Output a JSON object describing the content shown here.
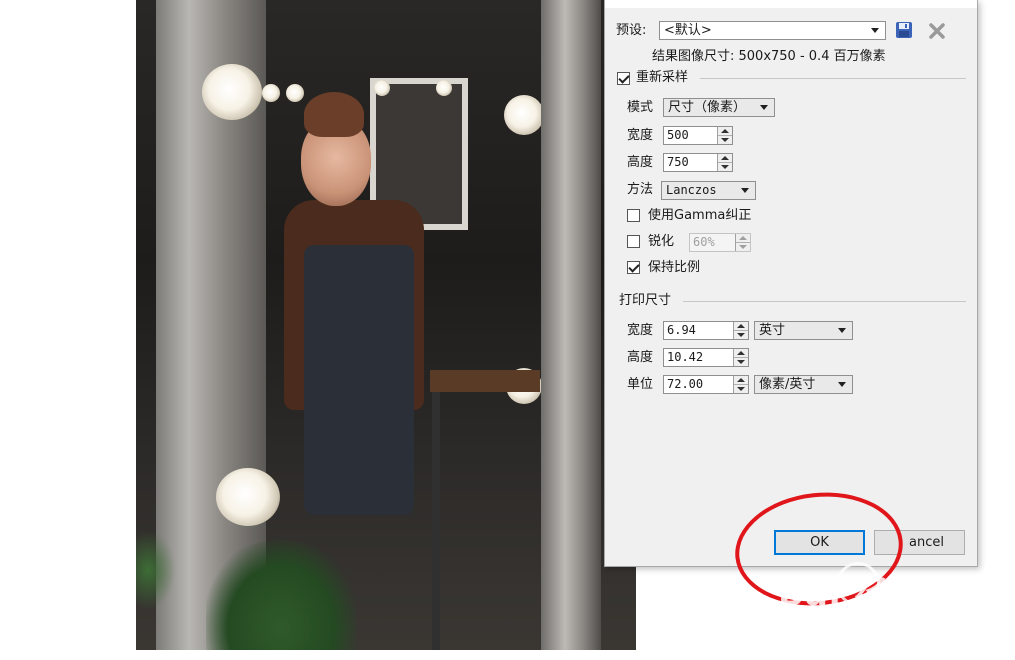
{
  "dialog": {
    "preset_label": "预设:",
    "preset_value": "<默认>",
    "result_info": "结果图像尺寸: 500x750 - 0.4 百万像素",
    "resample": {
      "label": "重新采样",
      "checked": true,
      "mode_label": "模式",
      "mode_value": "尺寸（像素）",
      "width_label": "宽度",
      "width_value": "500",
      "height_label": "高度",
      "height_value": "750",
      "method_label": "方法",
      "method_value": "Lanczos",
      "gamma_label": "使用Gamma纠正",
      "gamma_checked": false,
      "sharpen_label": "锐化",
      "sharpen_checked": false,
      "sharpen_value": "60%",
      "keep_ratio_label": "保持比例",
      "keep_ratio_checked": true
    },
    "print": {
      "title": "打印尺寸",
      "width_label": "宽度",
      "width_value": "6.94",
      "width_unit": "英寸",
      "height_label": "高度",
      "height_value": "10.42",
      "unit_label": "单位",
      "unit_value": "72.00",
      "unit_unit": "像素/英寸"
    },
    "ok_label": "OK",
    "cancel_label": "ancel"
  },
  "watermark": {
    "logo": "Bai 经验",
    "url": "jingyan.baidu.com"
  },
  "colors": {
    "annotation_red": "#e0161b",
    "dialog_bg": "#f0f0f0",
    "focus_blue": "#0078d7"
  },
  "icons": [
    "save-preset-icon",
    "delete-preset-icon",
    "chevron-down-icon"
  ]
}
